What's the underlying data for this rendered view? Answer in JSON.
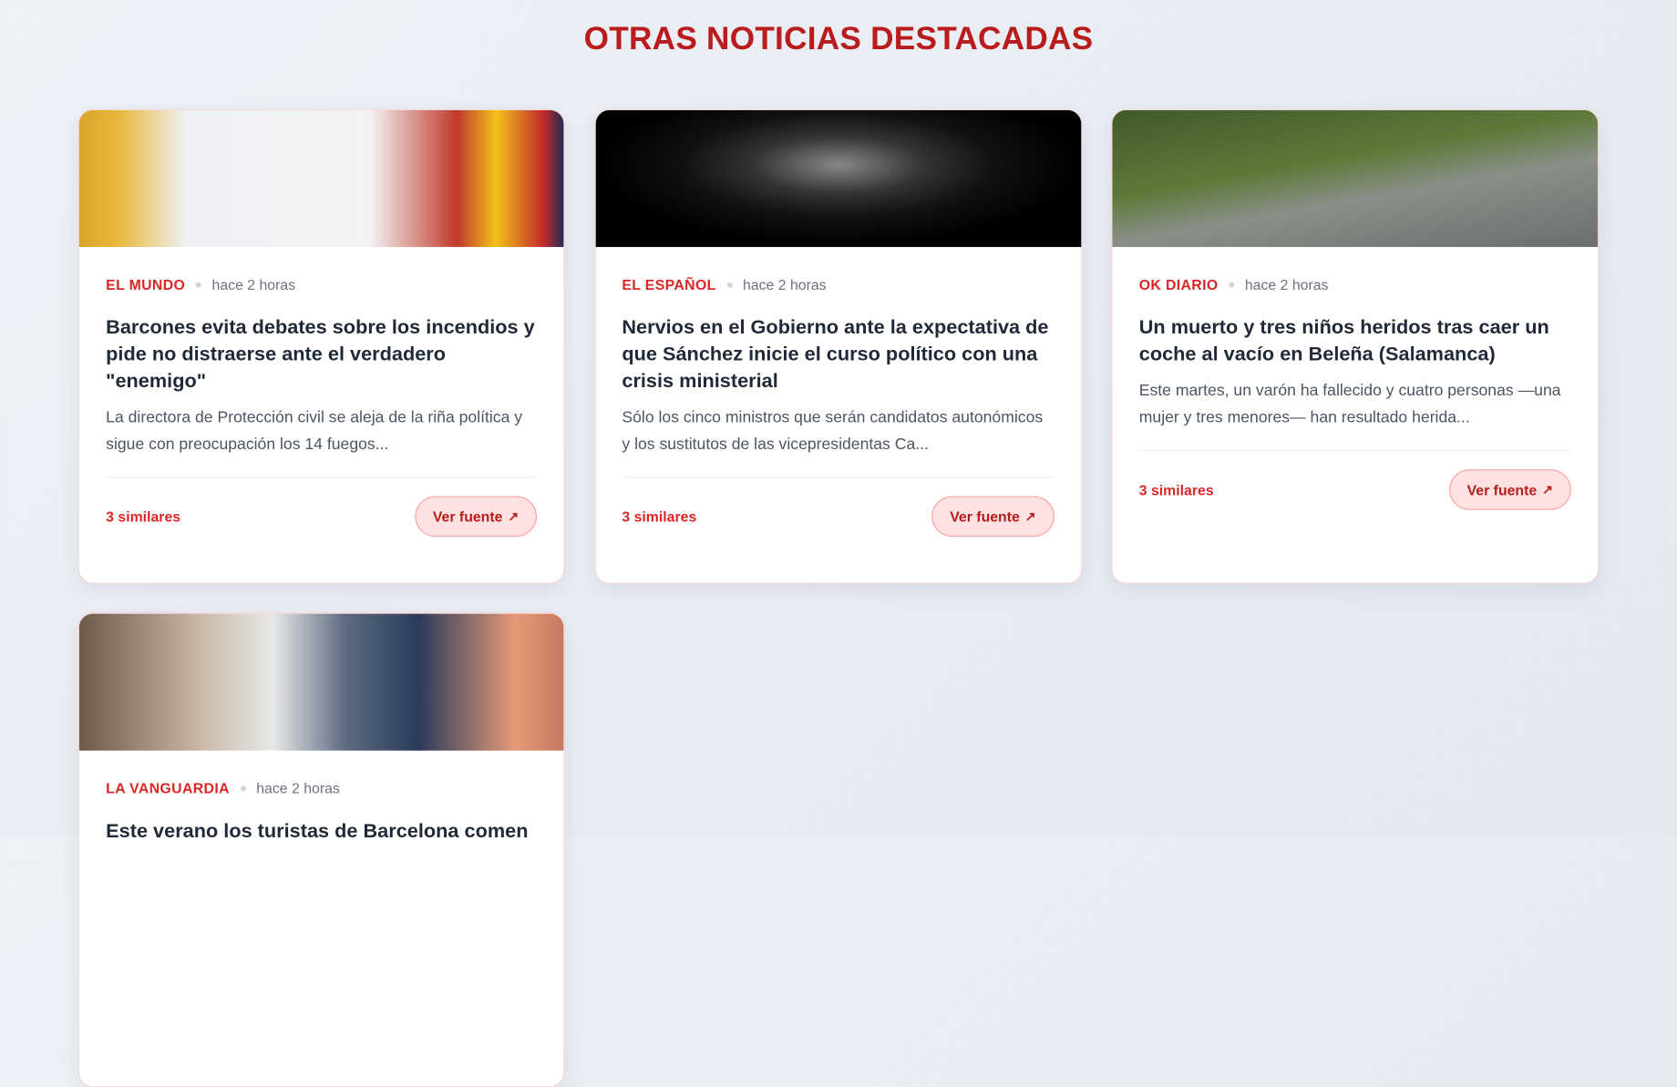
{
  "section": {
    "title": "OTRAS NOTICIAS DESTACADAS"
  },
  "colors": {
    "accent": "#dc2626",
    "title": "#b91c1c",
    "button_bg": "#fee2e2"
  },
  "cards": [
    {
      "source": "EL MUNDO",
      "time": "hace 2 horas",
      "title": "Barcones evita debates sobre los incendios y pide no distraerse ante el verdadero \"enemigo\"",
      "excerpt": "La directora de Protección civil se aleja de la riña política y sigue con preocupación los 14 fuegos...",
      "similar": "3 similares",
      "button": "Ver fuente",
      "button_icon": "↗"
    },
    {
      "source": "EL ESPAÑOL",
      "time": "hace 2 horas",
      "title": "Nervios en el Gobierno ante la expectativa de que Sánchez inicie el curso político con una crisis ministerial",
      "excerpt": "Sólo los cinco ministros que serán candidatos autonómicos y los sustitutos de las vicepresidentas Ca...",
      "similar": "3 similares",
      "button": "Ver fuente",
      "button_icon": "↗"
    },
    {
      "source": "OK DIARIO",
      "time": "hace 2 horas",
      "title": "Un muerto y tres niños heridos tras caer un coche al vacío en Beleña (Salamanca)",
      "excerpt": "Este martes, un varón ha fallecido y cuatro personas —una mujer y tres menores— han resultado herida...",
      "similar": "3 similares",
      "button": "Ver fuente",
      "button_icon": "↗"
    },
    {
      "source": "LA VANGUARDIA",
      "time": "hace 2 horas",
      "title": "Este verano los turistas de Barcelona comen",
      "excerpt": "",
      "similar": "",
      "button": "",
      "button_icon": ""
    }
  ]
}
